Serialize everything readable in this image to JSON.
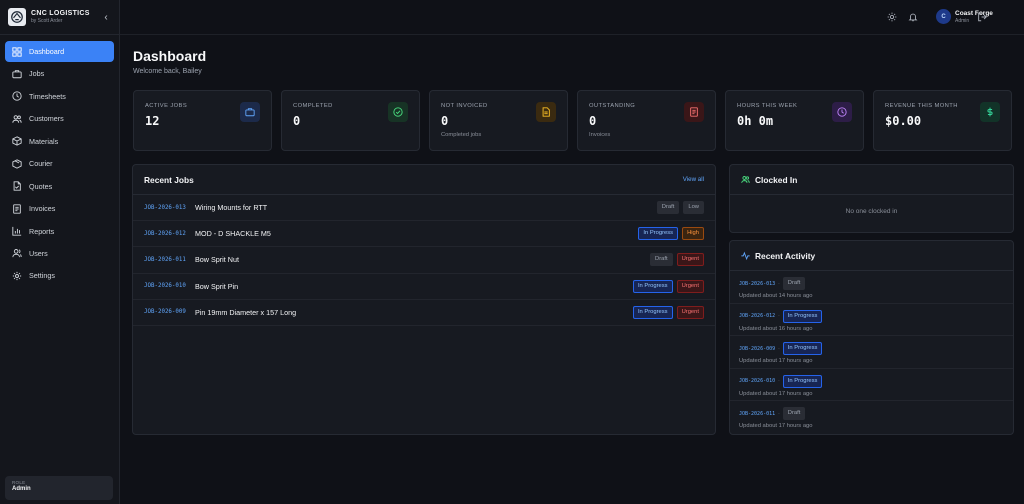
{
  "brand": {
    "name": "CNC LOGISTICS",
    "sub": "by Scott Arder"
  },
  "sidebar": {
    "items": [
      {
        "label": "Dashboard",
        "icon": "dashboard-icon",
        "active": true
      },
      {
        "label": "Jobs",
        "icon": "briefcase-icon"
      },
      {
        "label": "Timesheets",
        "icon": "clock-icon"
      },
      {
        "label": "Customers",
        "icon": "users-icon"
      },
      {
        "label": "Materials",
        "icon": "box-icon"
      },
      {
        "label": "Courier",
        "icon": "truck-icon"
      },
      {
        "label": "Quotes",
        "icon": "document-icon"
      },
      {
        "label": "Invoices",
        "icon": "invoice-icon"
      },
      {
        "label": "Reports",
        "icon": "chart-icon"
      },
      {
        "label": "Users",
        "icon": "user-group-icon"
      },
      {
        "label": "Settings",
        "icon": "gear-icon"
      }
    ],
    "role_label": "ROLE",
    "role_value": "Admin"
  },
  "topbar": {
    "user_initial": "C",
    "user_name": "Coast Forge",
    "user_role": "Admin"
  },
  "page": {
    "title": "Dashboard",
    "subtitle": "Welcome back, Bailey"
  },
  "stats": [
    {
      "label": "ACTIVE JOBS",
      "value": "12",
      "sub": "",
      "icon": "briefcase-icon",
      "color": "#3b82f6"
    },
    {
      "label": "COMPLETED",
      "value": "0",
      "sub": "",
      "icon": "check-circle-icon",
      "color": "#22c55e"
    },
    {
      "label": "NOT INVOICED",
      "value": "0",
      "sub": "Completed jobs",
      "icon": "document-icon",
      "color": "#f59e0b"
    },
    {
      "label": "OUTSTANDING",
      "value": "0",
      "sub": "Invoices",
      "icon": "invoice-icon",
      "color": "#ef4444"
    },
    {
      "label": "HOURS THIS WEEK",
      "value": "0h 0m",
      "sub": "",
      "icon": "clock-icon",
      "color": "#a855f7"
    },
    {
      "label": "REVENUE THIS MONTH",
      "value": "$0.00",
      "sub": "",
      "icon": "dollar-icon",
      "color": "#10b981"
    }
  ],
  "recent_jobs": {
    "title": "Recent Jobs",
    "view_all": "View all",
    "rows": [
      {
        "code": "JOB-2026-013",
        "name": "Wiring Mounts for RTT",
        "status": "Draft",
        "priority": "Low"
      },
      {
        "code": "JOB-2026-012",
        "name": "MOD - D SHACKLE M5",
        "status": "In Progress",
        "priority": "High"
      },
      {
        "code": "JOB-2026-011",
        "name": "Bow Sprit Nut",
        "status": "Draft",
        "priority": "Urgent"
      },
      {
        "code": "JOB-2026-010",
        "name": "Bow Sprit Pin",
        "status": "In Progress",
        "priority": "Urgent"
      },
      {
        "code": "JOB-2026-009",
        "name": "Pin 19mm Diameter x 157 Long",
        "status": "In Progress",
        "priority": "Urgent"
      }
    ]
  },
  "clocked_in": {
    "title": "Clocked In",
    "empty": "No one clocked in"
  },
  "recent_activity": {
    "title": "Recent Activity",
    "items": [
      {
        "code": "JOB-2026-013",
        "status": "Draft",
        "when": "Updated about 14 hours ago"
      },
      {
        "code": "JOB-2026-012",
        "status": "In Progress",
        "when": "Updated about 16 hours ago"
      },
      {
        "code": "JOB-2026-009",
        "status": "In Progress",
        "when": "Updated about 17 hours ago"
      },
      {
        "code": "JOB-2026-010",
        "status": "In Progress",
        "when": "Updated about 17 hours ago"
      },
      {
        "code": "JOB-2026-011",
        "status": "Draft",
        "when": "Updated about 17 hours ago"
      }
    ]
  }
}
